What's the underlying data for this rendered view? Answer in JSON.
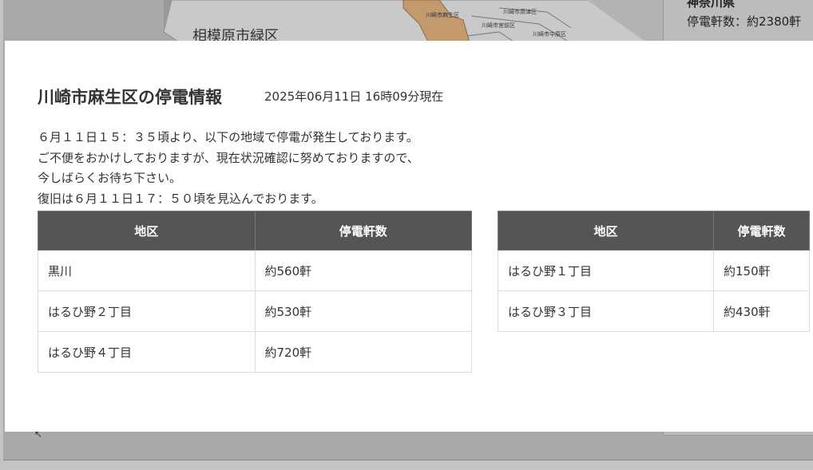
{
  "map": {
    "label": "相模原市緑区",
    "districts": [
      "川崎市麻生区",
      "川崎市高津区",
      "川崎市宮前区",
      "川崎市中原区"
    ]
  },
  "summary": {
    "prefecture": "神奈川県",
    "count": "停電軒数：約2380軒"
  },
  "modal": {
    "title": "川崎市麻生区の停電情報",
    "timestamp": "2025年06月11日 16時09分現在",
    "message": [
      "６月１１日１５：３５頃より、以下の地域で停電が発生しております。",
      "ご不便をおかけしておりますが、現在状況確認に努めておりますので、",
      "今しばらくお待ち下さい。",
      "復旧は６月１１日１７：５０頃を見込んでおります。"
    ],
    "headers": {
      "area": "地区",
      "count": "停電軒数"
    },
    "left_rows": [
      {
        "area": "黒川",
        "count": "約560軒"
      },
      {
        "area": "はるひ野２丁目",
        "count": "約530軒"
      },
      {
        "area": "はるひ野４丁目",
        "count": "約720軒"
      }
    ],
    "right_rows": [
      {
        "area": "はるひ野１丁目",
        "count": "約150軒"
      },
      {
        "area": "はるひ野３丁目",
        "count": "約430軒"
      }
    ]
  }
}
